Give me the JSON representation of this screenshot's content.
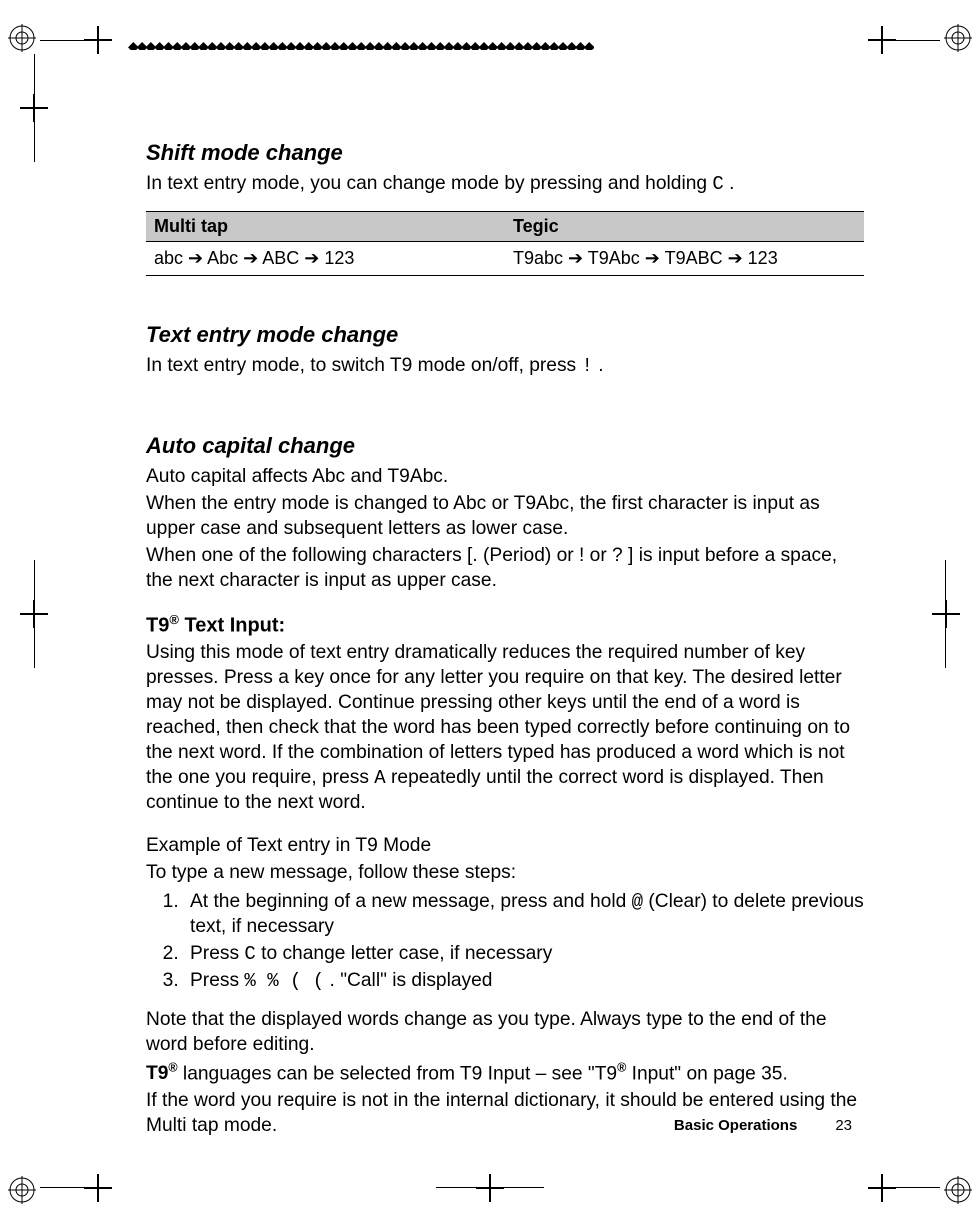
{
  "sections": {
    "shift": {
      "title": "Shift mode change",
      "intro_a": "In text entry mode, you can change mode by pressing and holding ",
      "intro_key": "C",
      "intro_b": " ."
    },
    "table": {
      "h1": "Multi tap",
      "h2": "Tegic",
      "c1": " abc ➔ Abc ➔ ABC ➔ 123",
      "c2": "T9abc ➔ T9Abc ➔ T9ABC ➔ 123"
    },
    "textentry": {
      "title": "Text entry mode change",
      "intro_a": "In text entry mode, to switch T9 mode on/off, press ",
      "intro_key": "!",
      "intro_b": " ."
    },
    "auto": {
      "title": "Auto capital change",
      "p1": "Auto capital affects Abc and T9Abc.",
      "p2": "When the entry mode is changed to Abc or T9Abc, the first character is input as upper case and subsequent letters as lower case.",
      "p3": "When one of the following characters [. (Period) or ! or ? ] is input before a space, the next character is input as upper case."
    },
    "t9": {
      "title_a": "T9",
      "title_b": " Text Input:",
      "p1a": "Using this mode of text entry dramatically reduces the required number of key presses. Press a key once for any letter you require on that key. The desired letter may not be displayed. Continue pressing other keys until the end of a word is reached, then check that the word has been typed correctly before continuing on to the next word. If the combination of letters typed has produced a word which is not the one you require, press ",
      "p1_key": "A",
      "p1b": " repeatedly until the correct word is displayed. Then continue to the next word.",
      "example": "Example of Text entry in T9 Mode",
      "follow": "To type a new message, follow these steps:",
      "step1a": "At the beginning of a new message, press and hold ",
      "step1_key": "@",
      "step1b": " (Clear) to delete previous text, if necessary",
      "step2a": "Press ",
      "step2_key": "C",
      "step2b": " to change letter case, if necessary",
      "step3a": "Press ",
      "step3_keys": "%  %  (   (",
      "step3b": " . \"Call\" is displayed",
      "note": "Note that the displayed words change as you type. Always type to the end of the word before editing.",
      "lang_a": "T9",
      "lang_b": " languages can be selected from T9 Input – see \"T9",
      "lang_c": " Input\" on page 35.",
      "dict": "If the word you require is not in the internal dictionary, it should be entered using the Multi tap mode."
    }
  },
  "footer": {
    "label": "Basic Operations",
    "page": "23"
  },
  "reg_sup": "®"
}
